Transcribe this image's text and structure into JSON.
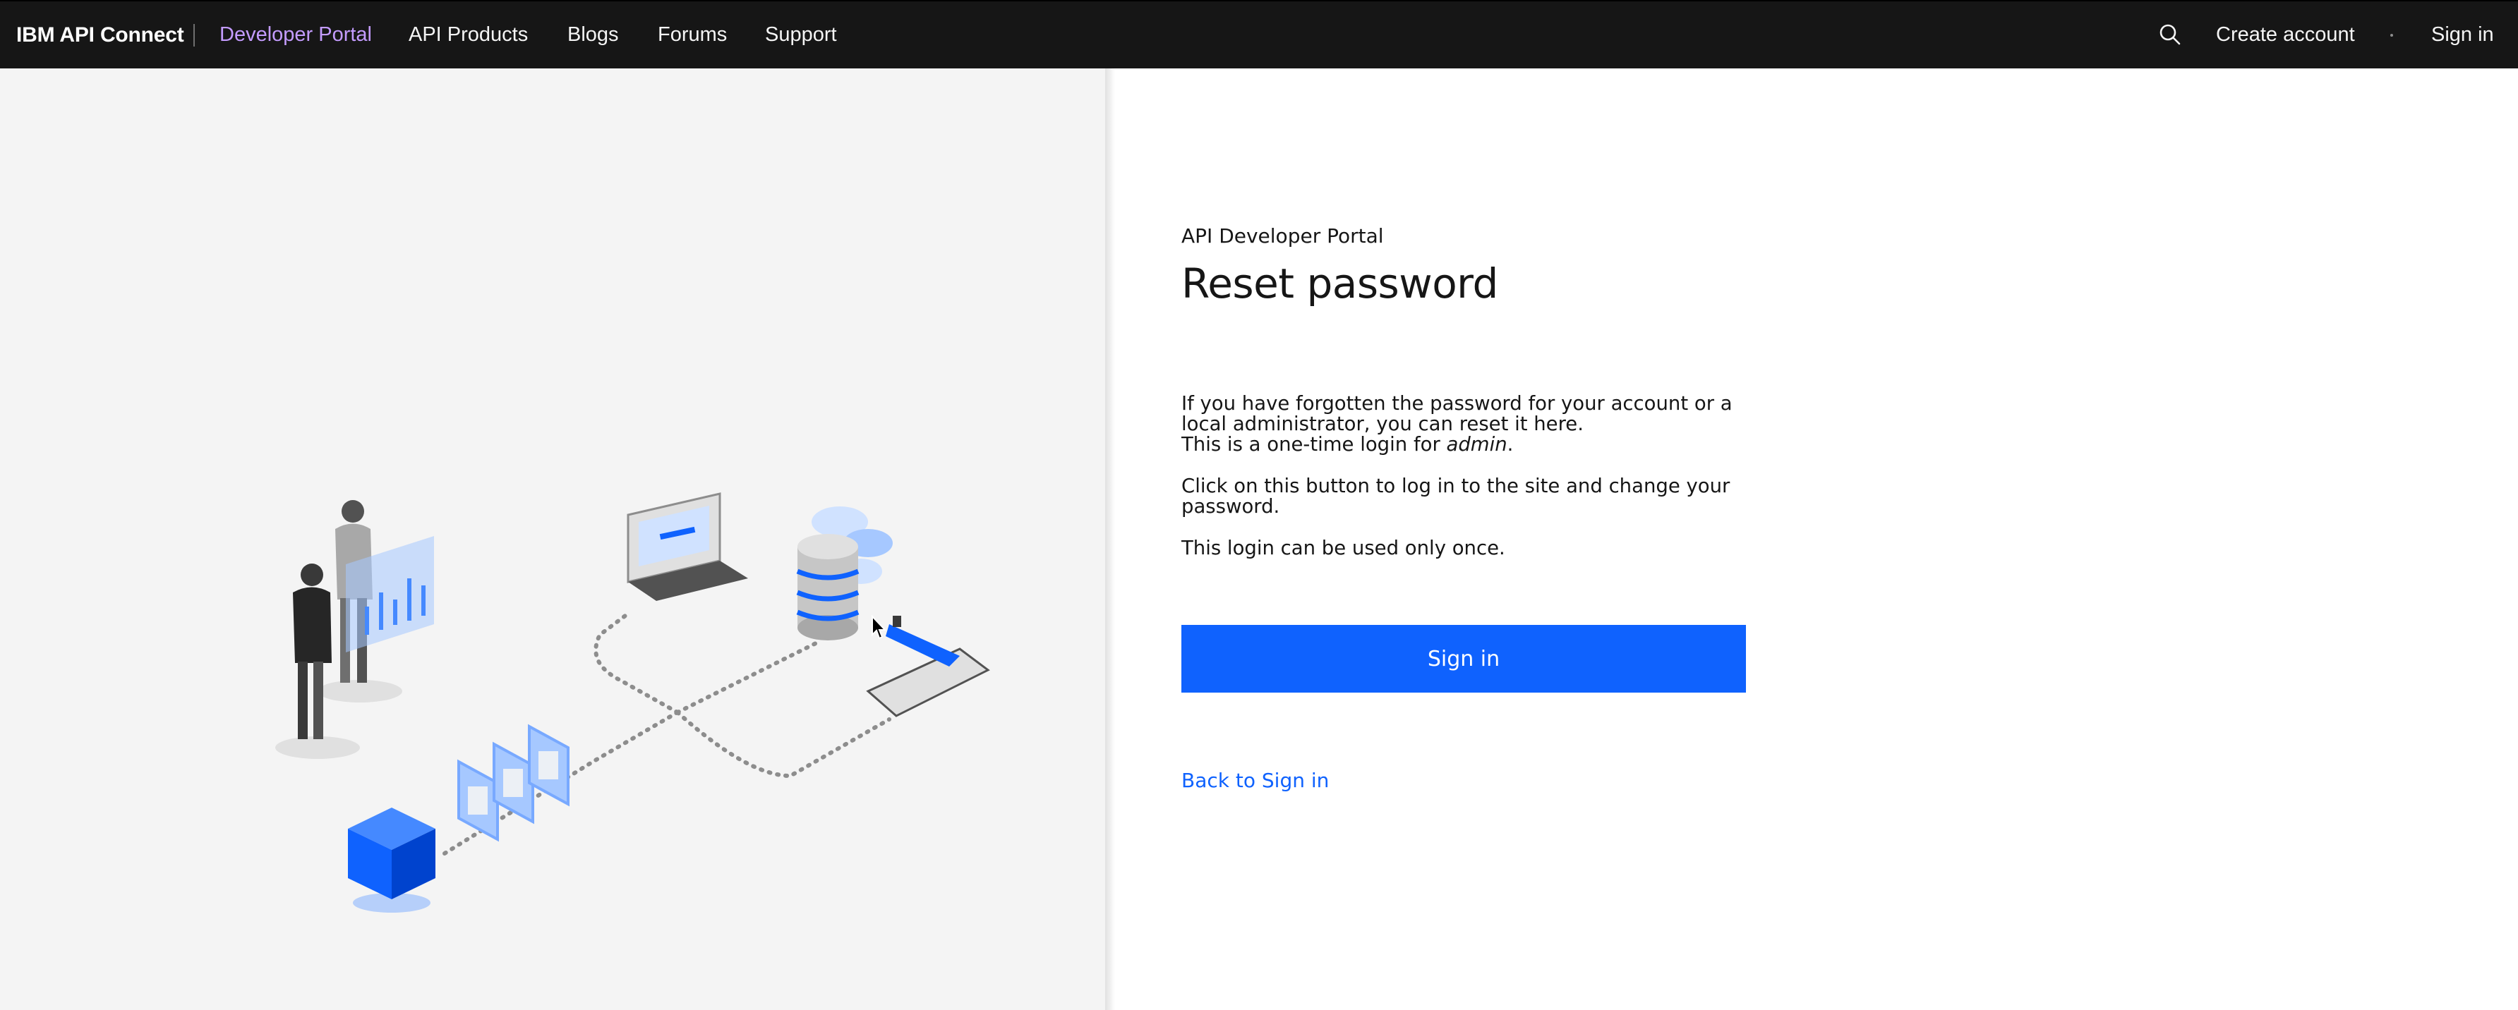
{
  "header": {
    "brand": "IBM API Connect",
    "nav": [
      {
        "label": "Developer Portal",
        "active": true
      },
      {
        "label": "API Products"
      },
      {
        "label": "Blogs"
      },
      {
        "label": "Forums"
      },
      {
        "label": "Support"
      }
    ],
    "search_icon": "search-icon",
    "create_account": "Create account",
    "sign_in": "Sign in"
  },
  "main": {
    "eyebrow": "API Developer Portal",
    "title": "Reset password",
    "para1_line1": "If you have forgotten the password for your account or a local administrator, you can reset it here.",
    "para1_line2_prefix": "This is a one-time login for ",
    "para1_user": "admin",
    "para1_line2_suffix": ".",
    "para2": "Click on this button to log in to the site and change your password.",
    "para3": "This login can be used only once.",
    "button_label": "Sign in",
    "back_link": "Back to Sign in"
  },
  "colors": {
    "topbar": "#161616",
    "active_nav": "#c49cff",
    "primary": "#0f62fe",
    "left_panel": "#f4f4f4"
  }
}
